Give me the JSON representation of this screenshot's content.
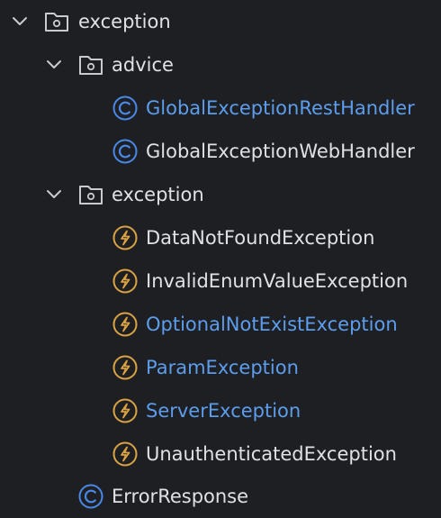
{
  "colors": {
    "background": "#1e1f22",
    "text_default": "#dfe1e5",
    "text_modified": "#5c9ded",
    "class_icon": "#4a88e8",
    "exception_icon": "#d9a343",
    "folder_icon": "#c8cbd0",
    "chevron": "#c8cbd0"
  },
  "tree": [
    {
      "label": "exception",
      "icon": "folder-icon",
      "expanded": true,
      "depth": 0
    },
    {
      "label": "advice",
      "icon": "folder-icon",
      "expanded": true,
      "depth": 1
    },
    {
      "label": "GlobalExceptionRestHandler",
      "icon": "class-icon",
      "depth": 2,
      "modified": true
    },
    {
      "label": "GlobalExceptionWebHandler",
      "icon": "class-icon",
      "depth": 2,
      "modified": false
    },
    {
      "label": "exception",
      "icon": "folder-icon",
      "expanded": true,
      "depth": 1
    },
    {
      "label": "DataNotFoundException",
      "icon": "exception-icon",
      "depth": 2,
      "modified": false
    },
    {
      "label": "InvalidEnumValueException",
      "icon": "exception-icon",
      "depth": 2,
      "modified": false
    },
    {
      "label": "OptionalNotExistException",
      "icon": "exception-icon",
      "depth": 2,
      "modified": true
    },
    {
      "label": "ParamException",
      "icon": "exception-icon",
      "depth": 2,
      "modified": true
    },
    {
      "label": "ServerException",
      "icon": "exception-icon",
      "depth": 2,
      "modified": true
    },
    {
      "label": "UnauthenticatedException",
      "icon": "exception-icon",
      "depth": 2,
      "modified": false
    },
    {
      "label": "ErrorResponse",
      "icon": "class-icon",
      "depth": 1,
      "modified": false
    }
  ]
}
